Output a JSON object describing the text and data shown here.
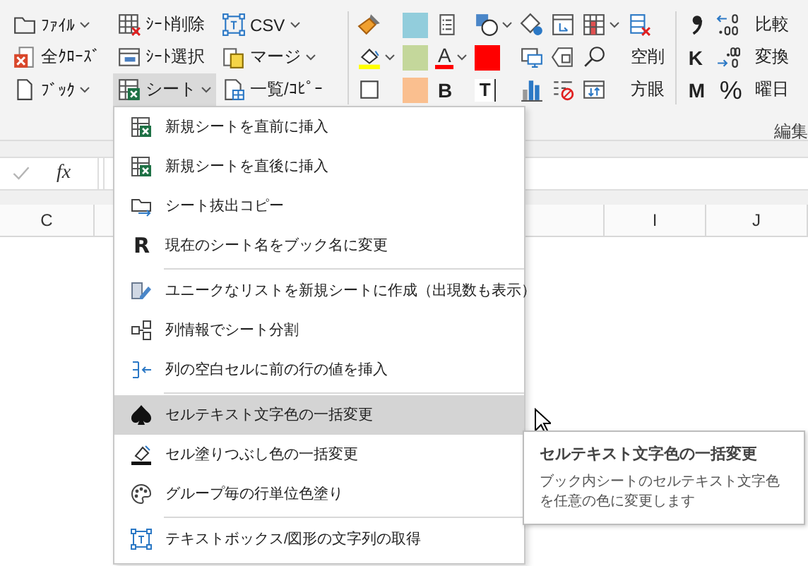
{
  "ribbon": {
    "file_buttons": [
      {
        "label": "ﾌｧｲﾙ",
        "dropdown": true,
        "selected": false
      },
      {
        "label": "全ｸﾛｰｽﾞ",
        "dropdown": false,
        "selected": false
      },
      {
        "label": "ﾌﾞｯｸ",
        "dropdown": true,
        "selected": false
      },
      {
        "label": "ｼｰﾄ削除",
        "dropdown": false,
        "selected": false
      },
      {
        "label": "ｼｰﾄ選択",
        "dropdown": false,
        "selected": false
      },
      {
        "label": "シート",
        "dropdown": true,
        "selected": true
      },
      {
        "label": "CSV",
        "dropdown": true,
        "selected": false
      },
      {
        "label": "マージ",
        "dropdown": true,
        "selected": false
      },
      {
        "label": "一覧/ｺﾋﾟｰ",
        "dropdown": false,
        "selected": false
      }
    ],
    "format_columns": [
      [
        {
          "kind": "icon",
          "dropdown": false
        },
        {
          "kind": "icon",
          "dropdown": true
        },
        {
          "kind": "icon",
          "dropdown": false
        }
      ],
      [
        {
          "kind": "swatch",
          "color": "#92cddc"
        },
        {
          "kind": "swatch",
          "color": "#c4d79b"
        },
        {
          "kind": "swatch",
          "color": "#fabf8f"
        }
      ],
      [
        {
          "kind": "icon",
          "dropdown": false
        },
        {
          "kind": "glyph",
          "text": "A",
          "dropdown": true
        },
        {
          "kind": "glyph",
          "text": "B",
          "dropdown": false
        }
      ],
      [
        {
          "kind": "icon",
          "dropdown": true
        },
        {
          "kind": "swatch",
          "color": "#ff0000"
        },
        {
          "kind": "glyph",
          "text": "T",
          "dropdown": false
        }
      ],
      [
        {
          "kind": "icon",
          "dropdown": false
        },
        {
          "kind": "icon",
          "dropdown": false
        },
        {
          "kind": "icon",
          "dropdown": false
        }
      ],
      [
        {
          "kind": "icon",
          "dropdown": false
        },
        {
          "kind": "icon",
          "dropdown": false
        },
        {
          "kind": "icon",
          "dropdown": false
        }
      ],
      [
        {
          "kind": "icon",
          "dropdown": true
        },
        {
          "kind": "icon",
          "dropdown": false
        },
        {
          "kind": "icon",
          "dropdown": false
        }
      ],
      [
        {
          "kind": "icon",
          "dropdown": false
        },
        {
          "kind": "label",
          "text": "空削"
        },
        {
          "kind": "label",
          "text": "方眼"
        }
      ]
    ],
    "number_columns": [
      [
        {
          "kind": "icon",
          "dropdown": false
        },
        {
          "kind": "glyph",
          "text": "K",
          "dropdown": false
        },
        {
          "kind": "glyph",
          "text": "M",
          "dropdown": false
        }
      ],
      [
        {
          "kind": "icon",
          "dropdown": false
        },
        {
          "kind": "icon",
          "dropdown": false
        },
        {
          "kind": "glyph",
          "text": "%",
          "dropdown": false
        }
      ],
      [
        {
          "kind": "label",
          "text": "比較"
        },
        {
          "kind": "label",
          "text": "変換"
        },
        {
          "kind": "label",
          "text": "曜日"
        }
      ]
    ],
    "group_label": "編集"
  },
  "formula_bar": {
    "function_label": "fx"
  },
  "column_headers": [
    {
      "label": "C"
    },
    {
      "label": "I"
    },
    {
      "label": "J"
    }
  ],
  "menu": {
    "sections": [
      [
        {
          "kind": "icon",
          "label": "新規シートを直前に挿入",
          "selected": false
        },
        {
          "kind": "icon",
          "label": "新規シートを直後に挿入",
          "selected": false
        },
        {
          "kind": "icon",
          "label": "シート抜出コピー",
          "selected": false
        },
        {
          "kind": "glyph",
          "glyph": "R",
          "label": "現在のシート名をブック名に変更",
          "selected": false
        }
      ],
      [
        {
          "kind": "icon",
          "label": "ユニークなリストを新規シートに作成（出現数も表示）",
          "selected": false
        },
        {
          "kind": "icon",
          "label": "列情報でシート分割",
          "selected": false
        },
        {
          "kind": "icon",
          "label": "列の空白セルに前の行の値を挿入",
          "selected": false
        }
      ],
      [
        {
          "kind": "icon",
          "label": "セルテキスト文字色の一括変更",
          "selected": true
        },
        {
          "kind": "icon",
          "label": "セル塗りつぶし色の一括変更",
          "selected": false
        },
        {
          "kind": "icon",
          "label": "グループ毎の行単位色塗り",
          "selected": false
        }
      ],
      [
        {
          "kind": "icon",
          "label": "テキストボックス/図形の文字列の取得",
          "selected": false
        }
      ]
    ]
  },
  "tooltip": {
    "title": "セルテキスト文字色の一括変更",
    "body": "ブック内シートのセルテキスト文字色を任意の色に変更します"
  }
}
